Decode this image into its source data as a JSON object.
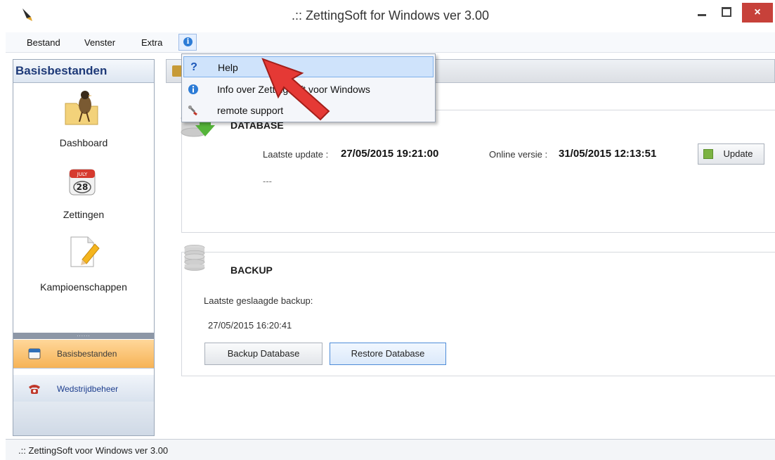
{
  "window": {
    "title": ".:: ZettingSoft for Windows ver 3.00",
    "close_glyph": "×"
  },
  "menubar": {
    "items": [
      "Bestand",
      "Venster",
      "Extra"
    ]
  },
  "dropdown": {
    "items": [
      {
        "label": "Help",
        "icon": "help-icon"
      },
      {
        "label": "Info over ZettingSoft voor Windows",
        "icon": "info-icon"
      },
      {
        "label": "remote support",
        "icon": "wrench-icon"
      }
    ]
  },
  "left_panel": {
    "header": "Basisbestanden",
    "tiles": [
      {
        "label": "Dashboard",
        "icon": "bird-folder-icon"
      },
      {
        "label": "Zettingen",
        "icon": "calendar-icon",
        "calendar_day": "28",
        "calendar_month": "JULY"
      },
      {
        "label": "Kampioenschappen",
        "icon": "edit-document-icon"
      }
    ],
    "splitter": "......",
    "nav_buttons": [
      {
        "label": "Basisbestanden",
        "icon": "calendar-small-icon",
        "active": true
      },
      {
        "label": "Wedstrijdbeheer",
        "icon": "telephone-icon",
        "active": false
      }
    ]
  },
  "database": {
    "title": "DATABASE",
    "last_update_label": "Laatste update :",
    "last_update_value": "27/05/2015 19:21:00",
    "online_label": "Online versie :",
    "online_value": "31/05/2015 12:13:51",
    "update_button": "Update",
    "status": "---"
  },
  "backup": {
    "title": "BACKUP",
    "last_backup_label": "Laatste geslaagde backup:",
    "last_backup_value": "27/05/2015 16:20:41",
    "backup_button": "Backup Database",
    "restore_button": "Restore Database"
  },
  "statusbar": {
    "text": ".:: ZettingSoft voor Windows ver 3.00"
  },
  "colors": {
    "close_red": "#c7413a",
    "active_nav_orange": "#f6b356",
    "header_blue": "#1e3a78",
    "arrow_red": "#e53935"
  }
}
